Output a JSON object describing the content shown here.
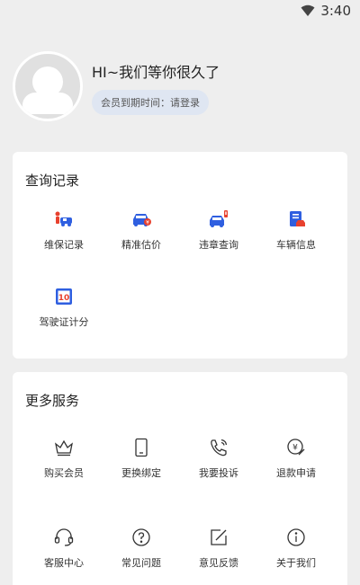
{
  "status_bar": {
    "time": "3:40"
  },
  "profile": {
    "greeting": "HI~我们等你很久了",
    "member_expiry": "会员到期时间：请登录"
  },
  "records": {
    "title": "查询记录",
    "items": [
      {
        "label": "维保记录",
        "icon": "maintenance-icon"
      },
      {
        "label": "精准估价",
        "icon": "valuation-icon"
      },
      {
        "label": "违章查询",
        "icon": "violation-icon"
      },
      {
        "label": "车辆信息",
        "icon": "vehicle-info-icon"
      },
      {
        "label": "驾驶证计分",
        "icon": "license-points-icon"
      }
    ]
  },
  "services": {
    "title": "更多服务",
    "items": [
      {
        "label": "购买会员",
        "icon": "crown-icon"
      },
      {
        "label": "更换绑定",
        "icon": "phone-icon"
      },
      {
        "label": "我要投诉",
        "icon": "call-icon"
      },
      {
        "label": "退款申请",
        "icon": "refund-icon"
      },
      {
        "label": "客服中心",
        "icon": "headset-icon"
      },
      {
        "label": "常见问题",
        "icon": "question-icon"
      },
      {
        "label": "意见反馈",
        "icon": "feedback-icon"
      },
      {
        "label": "关于我们",
        "icon": "info-icon"
      }
    ]
  },
  "colors": {
    "accent_blue": "#2f5fe0",
    "accent_red": "#e8412e"
  }
}
